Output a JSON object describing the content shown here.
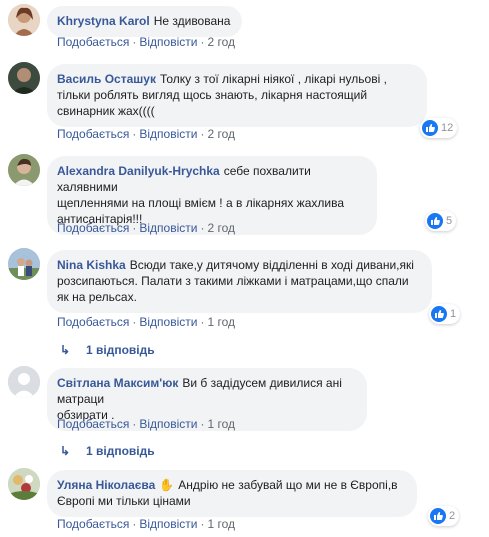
{
  "actions": {
    "like": "Подобається",
    "reply": "Відповісти",
    "separator": "·"
  },
  "colors": {
    "author": "#385898",
    "bubble": "#f2f3f5",
    "meta": "#616770",
    "like": "#1877f2"
  },
  "comments": [
    {
      "author": "Khrystyna Karol",
      "text": "Не здивована",
      "time": "2 год"
    },
    {
      "author": "Василь Осташук",
      "text": "Толку з тої лікарні ніякої , лікарі нульові ,\nтільки роблять вигляд щось знають, лікарня настоящий\nсвинарник жах((((",
      "time": "2 год",
      "reactions": "12"
    },
    {
      "author": "Alexandra Danilyuk-Hrychka",
      "text": "себе похвалити халявними\nщепленнями на площі вмієм ! а в лікарнях жахлива\nантисанітарія!!!",
      "time": "2 год",
      "reactions": "5"
    },
    {
      "author": "Nina Kishka",
      "text": "Всюди таке,у дитячому відділенні в ході дивани,які\nрозсипаються. Палати з такими ліжками і матрацами,що спали\nяк на рельсах.",
      "time": "1 год",
      "reactions": "1",
      "replies": "1 відповідь"
    },
    {
      "author": "Світлана Максим'юк",
      "text": "Ви б задідусем дивилися ані матраци\nобзирати .",
      "time": "1 год",
      "replies": "1 відповідь"
    },
    {
      "author": "Уляна Ніколаєва",
      "text": "Андрію не забувай що ми не в Європі,в\nЄвропі ми тільки цінами",
      "time": "1 год",
      "reactions": "2"
    }
  ]
}
